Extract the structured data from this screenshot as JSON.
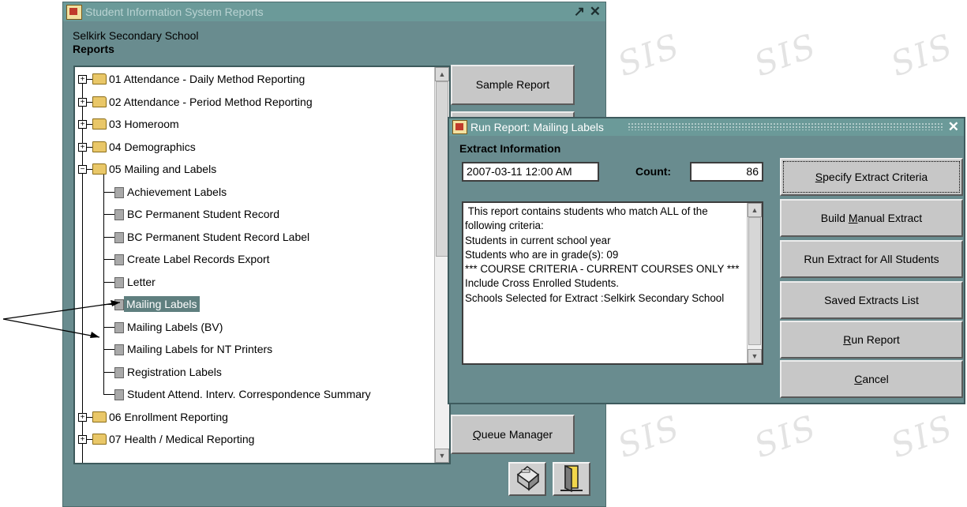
{
  "window": {
    "title": "Student Information System Reports",
    "controls": {
      "restore": "↗",
      "close": "✕"
    },
    "school_name": "Selkirk Secondary School",
    "section_title": "Reports"
  },
  "background": {
    "logo_text": "SIS"
  },
  "tree": {
    "items": [
      {
        "label": "01 Attendance - Daily Method Reporting",
        "type": "folder",
        "expanded": false
      },
      {
        "label": "02 Attendance - Period Method Reporting",
        "type": "folder",
        "expanded": false
      },
      {
        "label": "03 Homeroom",
        "type": "folder",
        "expanded": false
      },
      {
        "label": "04 Demographics",
        "type": "folder",
        "expanded": false
      },
      {
        "label": "05 Mailing and Labels",
        "type": "folder",
        "expanded": true
      },
      {
        "label": "Achievement Labels",
        "type": "report"
      },
      {
        "label": "BC Permanent Student Record",
        "type": "report"
      },
      {
        "label": "BC Permanent Student Record Label",
        "type": "report"
      },
      {
        "label": "Create Label Records Export",
        "type": "report"
      },
      {
        "label": "Letter",
        "type": "report"
      },
      {
        "label": "Mailing Labels",
        "type": "report",
        "selected": true
      },
      {
        "label": "Mailing Labels (BV)",
        "type": "report"
      },
      {
        "label": "Mailing Labels for NT Printers",
        "type": "report"
      },
      {
        "label": "Registration Labels",
        "type": "report"
      },
      {
        "label": "Student Attend. Interv. Correspondence Summary",
        "type": "report"
      },
      {
        "label": "06 Enrollment Reporting",
        "type": "folder",
        "expanded": false
      },
      {
        "label": "07 Health / Medical Reporting",
        "type": "folder",
        "expanded": false
      }
    ]
  },
  "buttons": {
    "sample_report": "Sample Report",
    "queue_manager_prefix": "",
    "queue_manager_key": "Q",
    "queue_manager_rest": "ueue Manager"
  },
  "dialog": {
    "title": "Run Report: Mailing Labels",
    "close": "✕",
    "section_label": "Extract Information",
    "date_value": "2007-03-11 12:00 AM",
    "count_label": "Count:",
    "count_value": "86",
    "description": " This report contains students who match ALL of the following criteria:\nStudents in current school year\nStudents who are in grade(s): 09\n*** COURSE CRITERIA - CURRENT COURSES ONLY ***\nInclude Cross Enrolled Students.\nSchools Selected for Extract :Selkirk Secondary School",
    "buttons": {
      "specify_key": "S",
      "specify_rest": "pecify Extract Criteria",
      "build_pre": "Build ",
      "build_key": "M",
      "build_rest": "anual Extract",
      "run_all": "Run Extract for All Students",
      "saved": "Saved Extracts List",
      "run_key": "R",
      "run_rest": "un Report",
      "cancel_key": "C",
      "cancel_rest": "ancel"
    }
  }
}
